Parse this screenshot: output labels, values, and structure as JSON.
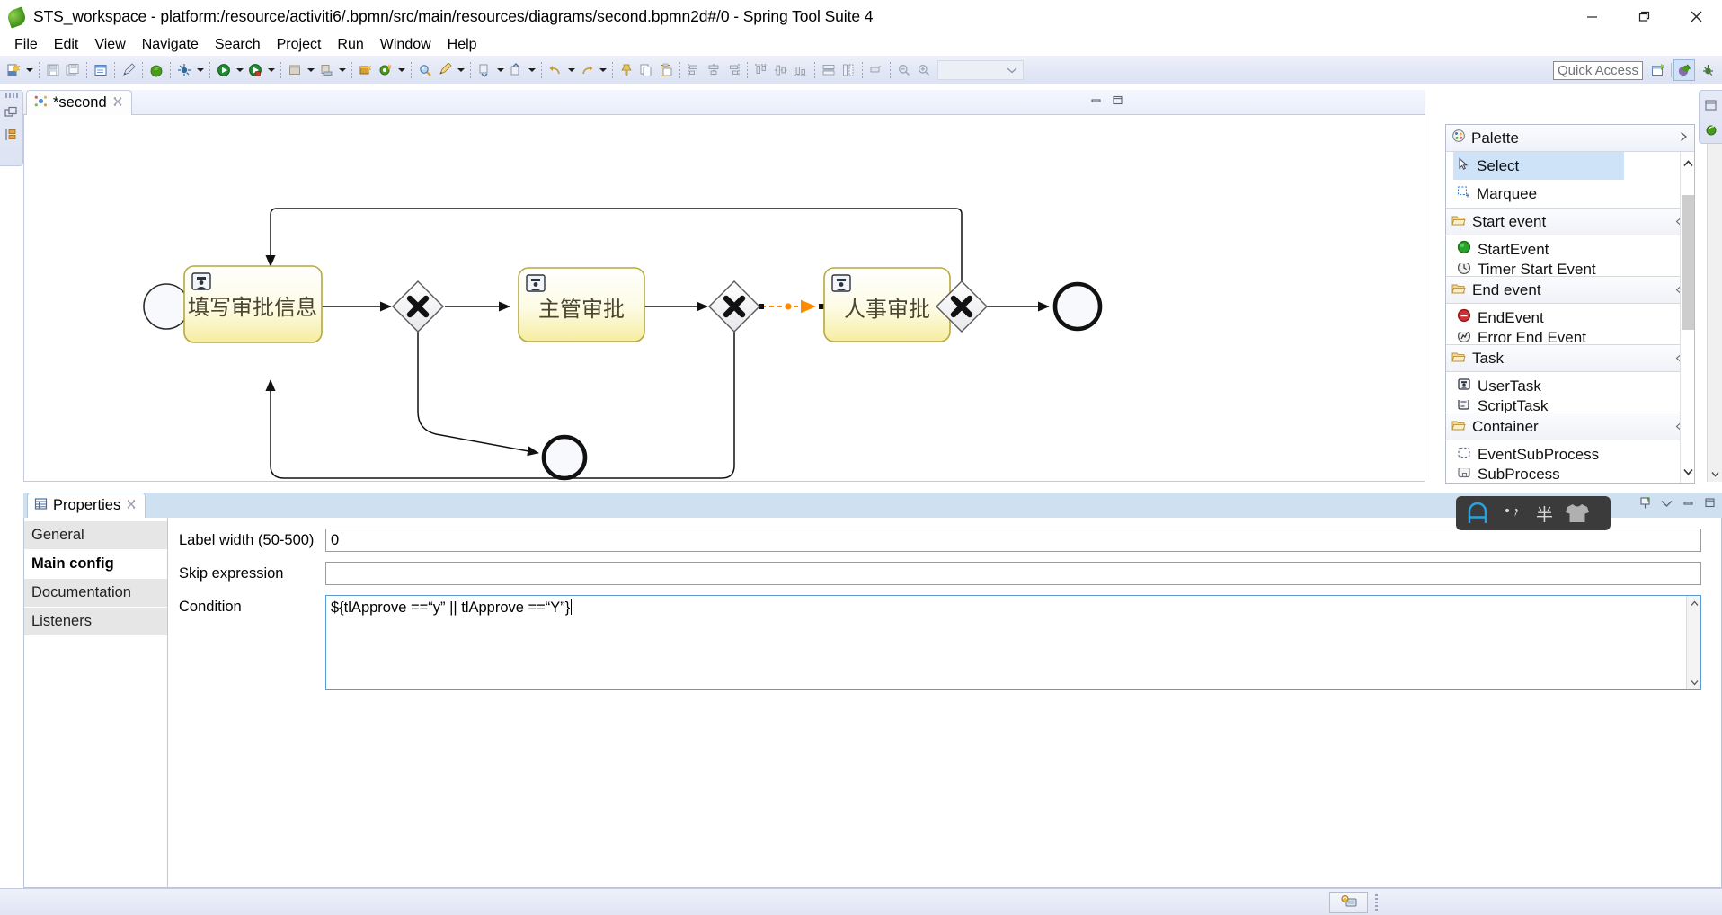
{
  "window": {
    "title": "STS_workspace - platform:/resource/activiti6/.bpmn/src/main/resources/diagrams/second.bpmn2d#/0 - Spring Tool Suite 4",
    "app_icon": "sts-leaf-icon",
    "minimize": "minimize-icon",
    "maximize": "restore-icon",
    "close": "close-icon"
  },
  "menubar": {
    "items": [
      "File",
      "Edit",
      "View",
      "Navigate",
      "Search",
      "Project",
      "Run",
      "Window",
      "Help"
    ]
  },
  "toolbar": {
    "quick_access_placeholder": "Quick Access",
    "buttons": [
      {
        "name": "new-wizard",
        "icon": "new-file-icon"
      },
      {
        "name": "new-dropdown",
        "icon": "chevron-down-icon"
      },
      {
        "name": "save",
        "icon": "save-icon"
      },
      {
        "name": "save-all",
        "icon": "save-all-icon"
      },
      {
        "name": "open-console",
        "icon": "console-icon"
      },
      {
        "name": "link-editor",
        "icon": "pen-icon"
      },
      {
        "name": "boot-dashboard",
        "icon": "boot-icon"
      },
      {
        "name": "external-tools",
        "icon": "ant-icon"
      },
      {
        "name": "external-tools-dropdown",
        "icon": "chevron-down-icon"
      },
      {
        "name": "run",
        "icon": "run-icon"
      },
      {
        "name": "run-dropdown",
        "icon": "chevron-down-icon"
      },
      {
        "name": "debug",
        "icon": "debug-icon"
      },
      {
        "name": "debug-dropdown",
        "icon": "chevron-down-icon"
      },
      {
        "name": "coverage",
        "icon": "coverage-icon"
      },
      {
        "name": "coverage-dropdown",
        "icon": "chevron-down-icon"
      },
      {
        "name": "server",
        "icon": "server-icon"
      },
      {
        "name": "server-dropdown",
        "icon": "chevron-down-icon"
      },
      {
        "name": "new-package",
        "icon": "package-icon"
      },
      {
        "name": "new-class",
        "icon": "class-icon"
      },
      {
        "name": "new-class-dropdown",
        "icon": "chevron-down-icon"
      },
      {
        "name": "search",
        "icon": "search-icon"
      },
      {
        "name": "open-task",
        "icon": "task-icon"
      },
      {
        "name": "open-task-dropdown",
        "icon": "chevron-down-icon"
      },
      {
        "name": "next-annotation",
        "icon": "next-annotation-icon"
      },
      {
        "name": "next-annotation-dropdown",
        "icon": "chevron-down-icon"
      },
      {
        "name": "prev-annotation",
        "icon": "prev-annotation-icon"
      },
      {
        "name": "prev-annotation-dropdown",
        "icon": "chevron-down-icon"
      },
      {
        "name": "back",
        "icon": "back-arrow-icon"
      },
      {
        "name": "back-dropdown",
        "icon": "chevron-down-icon"
      },
      {
        "name": "forward",
        "icon": "forward-arrow-icon"
      },
      {
        "name": "forward-dropdown",
        "icon": "chevron-down-icon"
      },
      {
        "name": "pin-editor",
        "icon": "pin-icon"
      },
      {
        "name": "copy",
        "icon": "copy-icon"
      },
      {
        "name": "paste",
        "icon": "paste-icon"
      },
      {
        "name": "align-left",
        "icon": "align-left-icon"
      },
      {
        "name": "align-center",
        "icon": "align-center-icon"
      },
      {
        "name": "align-right",
        "icon": "align-right-icon"
      },
      {
        "name": "align-top",
        "icon": "align-top-icon"
      },
      {
        "name": "align-middle",
        "icon": "align-middle-icon"
      },
      {
        "name": "align-bottom",
        "icon": "align-bottom-icon"
      },
      {
        "name": "match-width",
        "icon": "match-width-icon"
      },
      {
        "name": "match-height",
        "icon": "match-height-icon"
      },
      {
        "name": "toggle-grid",
        "icon": "grid-icon"
      },
      {
        "name": "zoom-out",
        "icon": "zoom-out-icon"
      },
      {
        "name": "zoom-in",
        "icon": "zoom-in-icon"
      }
    ],
    "zoom_value": "",
    "perspective_new": "open-perspective-icon",
    "perspective_spring": "spring-perspective-icon",
    "perspective_debug": "debug-perspective-icon"
  },
  "editor": {
    "tab_label": "*second",
    "tab_icon": "bpmn-diagram-icon",
    "tab_close": "close-icon",
    "dirty": true
  },
  "diagram": {
    "nodes": [
      {
        "id": "start",
        "type": "start-event",
        "label": ""
      },
      {
        "id": "task1",
        "type": "user-task",
        "label": "填写审批信息"
      },
      {
        "id": "gw1",
        "type": "exclusive-gateway",
        "label": ""
      },
      {
        "id": "task2",
        "type": "user-task",
        "label": "主管审批"
      },
      {
        "id": "gw2",
        "type": "exclusive-gateway",
        "label": ""
      },
      {
        "id": "task3",
        "type": "user-task",
        "label": "人事审批"
      },
      {
        "id": "gw3",
        "type": "exclusive-gateway",
        "label": ""
      },
      {
        "id": "end1",
        "type": "end-event",
        "label": ""
      },
      {
        "id": "end2",
        "type": "end-event",
        "label": ""
      }
    ],
    "selected_flow": {
      "from": "gw2",
      "to": "task3",
      "color": "#ff8c00",
      "selected": true
    }
  },
  "palette": {
    "title": "Palette",
    "title_icon": "palette-icon",
    "pin_icon": "chevron-right-icon",
    "tools": [
      {
        "label": "Select",
        "icon": "cursor-icon",
        "selected": true
      },
      {
        "label": "Marquee",
        "icon": "marquee-icon",
        "selected": false
      }
    ],
    "groups": [
      {
        "label": "Start event",
        "icon": "folder-open-icon",
        "collapse_icon": "collapse-icon",
        "items": [
          {
            "label": "StartEvent",
            "icon": "start-event-icon"
          }
        ]
      },
      {
        "label": "End event",
        "icon": "folder-open-icon",
        "collapse_icon": "collapse-icon",
        "items": [
          {
            "label": "EndEvent",
            "icon": "end-event-icon"
          }
        ]
      },
      {
        "label": "Task",
        "icon": "folder-open-icon",
        "collapse_icon": "collapse-icon",
        "items": [
          {
            "label": "UserTask",
            "icon": "user-task-icon"
          }
        ]
      },
      {
        "label": "Container",
        "icon": "folder-open-icon",
        "collapse_icon": "collapse-icon",
        "items": [
          {
            "label": "EventSubProcess",
            "icon": "event-subprocess-icon"
          }
        ]
      }
    ]
  },
  "properties": {
    "tab_label": "Properties",
    "tab_icon": "properties-icon",
    "tab_close": "close-icon",
    "nav": [
      {
        "label": "General",
        "active": false
      },
      {
        "label": "Main config",
        "active": true
      },
      {
        "label": "Documentation",
        "active": false
      },
      {
        "label": "Listeners",
        "active": false
      }
    ],
    "fields": [
      {
        "label": "Label width (50-500)",
        "value": "0",
        "type": "text"
      },
      {
        "label": "Skip expression",
        "value": "",
        "type": "text"
      },
      {
        "label": "Condition",
        "value": "${tlApprove ==“y” || tlApprove ==“Y”}",
        "type": "textarea",
        "focused": true
      }
    ],
    "view_menu_icon": "view-menu-icon",
    "minimize_icon": "minimize-icon",
    "maximize_icon": "maximize-icon",
    "pin_icon": "pin-view-icon"
  },
  "ime": {
    "logo": "pinyin-A-icon",
    "punctuation": "chinese-punctuation-icon",
    "width_mode": "半",
    "skin": "skin-shirt-icon"
  },
  "statusbar": {
    "cell_icon": "remote-system-icon"
  },
  "colors": {
    "task_fill_top": "#ffffff",
    "task_fill_bottom": "#f8f0a5",
    "task_text": "#4a4a2a",
    "selection": "#ff8c00",
    "accent": "#cfe3f8",
    "toolbar_bg": "#e2e7f5",
    "props_tab_bg": "#cfe0f0"
  }
}
